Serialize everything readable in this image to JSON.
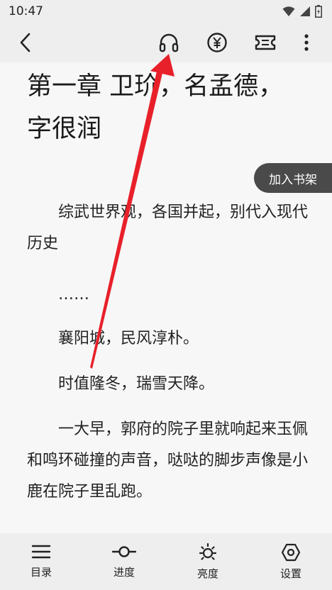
{
  "status_bar": {
    "time": "10:47"
  },
  "toolbar": {
    "back_icon": "chevron-left-icon",
    "listen_icon": "headphones-icon",
    "coin_icon": "yen-coin-icon",
    "ticket_icon": "ticket-icon",
    "more_icon": "more-vertical-icon"
  },
  "chapter": {
    "title": "第一章 卫玠，名孟德，\n字很润",
    "add_shelf_label": "加入书架",
    "paragraphs": [
      "综武世界观，各国并起，别代入现代历史",
      "……",
      "襄阳城，民风淳朴。",
      "时值隆冬，瑞雪天降。",
      "一大早，郭府的院子里就响起来玉佩和鸣环碰撞的声音，哒哒的脚步声像是小鹿在院子里乱跑。"
    ]
  },
  "bottom_nav": {
    "items": [
      {
        "label": "目录",
        "icon": "menu-icon"
      },
      {
        "label": "进度",
        "icon": "progress-icon"
      },
      {
        "label": "亮度",
        "icon": "brightness-icon"
      },
      {
        "label": "设置",
        "icon": "settings-icon"
      }
    ]
  },
  "annotation": {
    "color": "#e8202a"
  }
}
